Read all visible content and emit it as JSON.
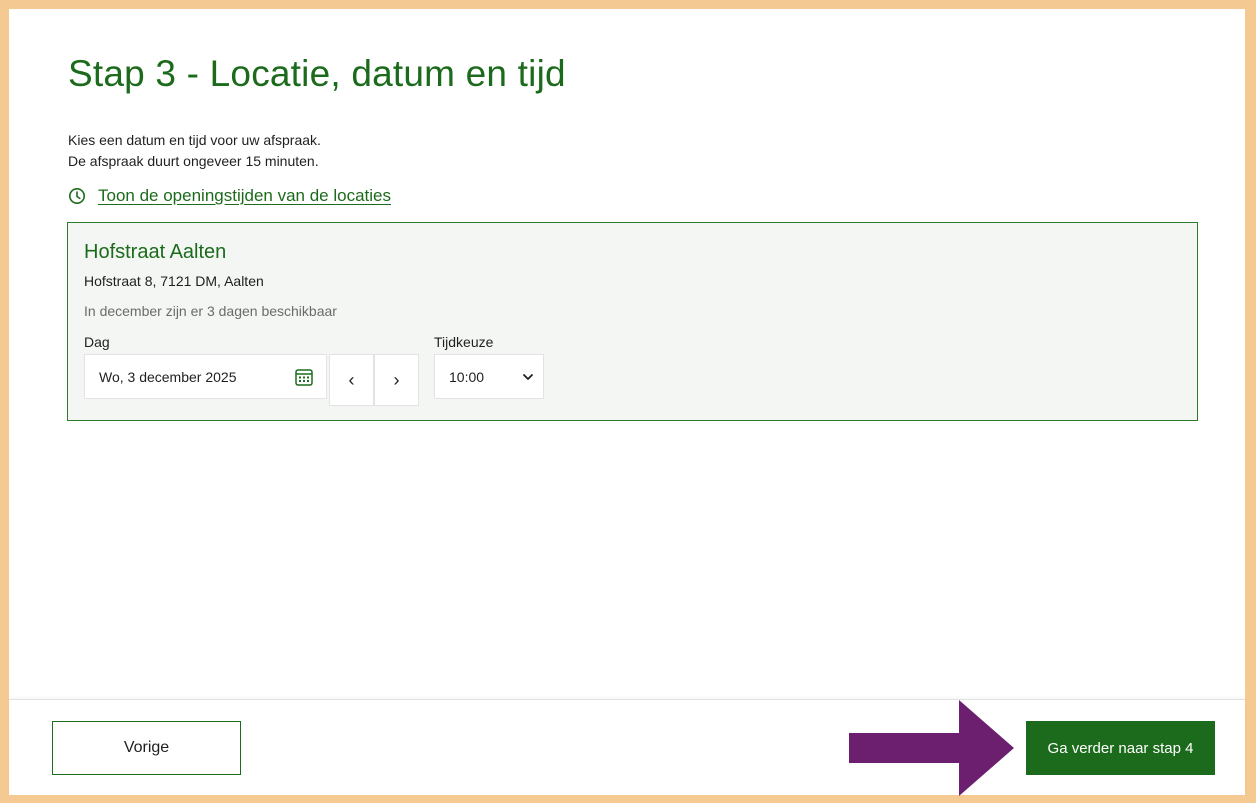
{
  "step": {
    "title": "Stap 3 - Locatie, datum en tijd",
    "intro_line1": "Kies een datum en tijd voor uw afspraak.",
    "intro_line2": "De afspraak duurt ongeveer 15 minuten.",
    "hours_link": "Toon de openingstijden van de locaties"
  },
  "location": {
    "name": "Hofstraat Aalten",
    "address": "Hofstraat 8, 7121 DM, Aalten",
    "availability": "In december zijn er 3 dagen beschikbaar",
    "day_label": "Dag",
    "day_value": "Wo, 3 december 2025",
    "time_label": "Tijdkeuze",
    "time_value": "10:00",
    "prev_glyph": "‹",
    "next_glyph": "›"
  },
  "footer": {
    "prev_label": "Vorige",
    "next_label": "Ga verder naar stap 4"
  },
  "colors": {
    "brand_green": "#1c6b1c",
    "frame_orange": "#f5c992",
    "arrow_purple": "#6b1f6e"
  },
  "icons": {
    "hours": "clock-icon",
    "date": "calendar-icon",
    "select": "chevron-down-icon",
    "annotation": "arrow-right-icon"
  }
}
